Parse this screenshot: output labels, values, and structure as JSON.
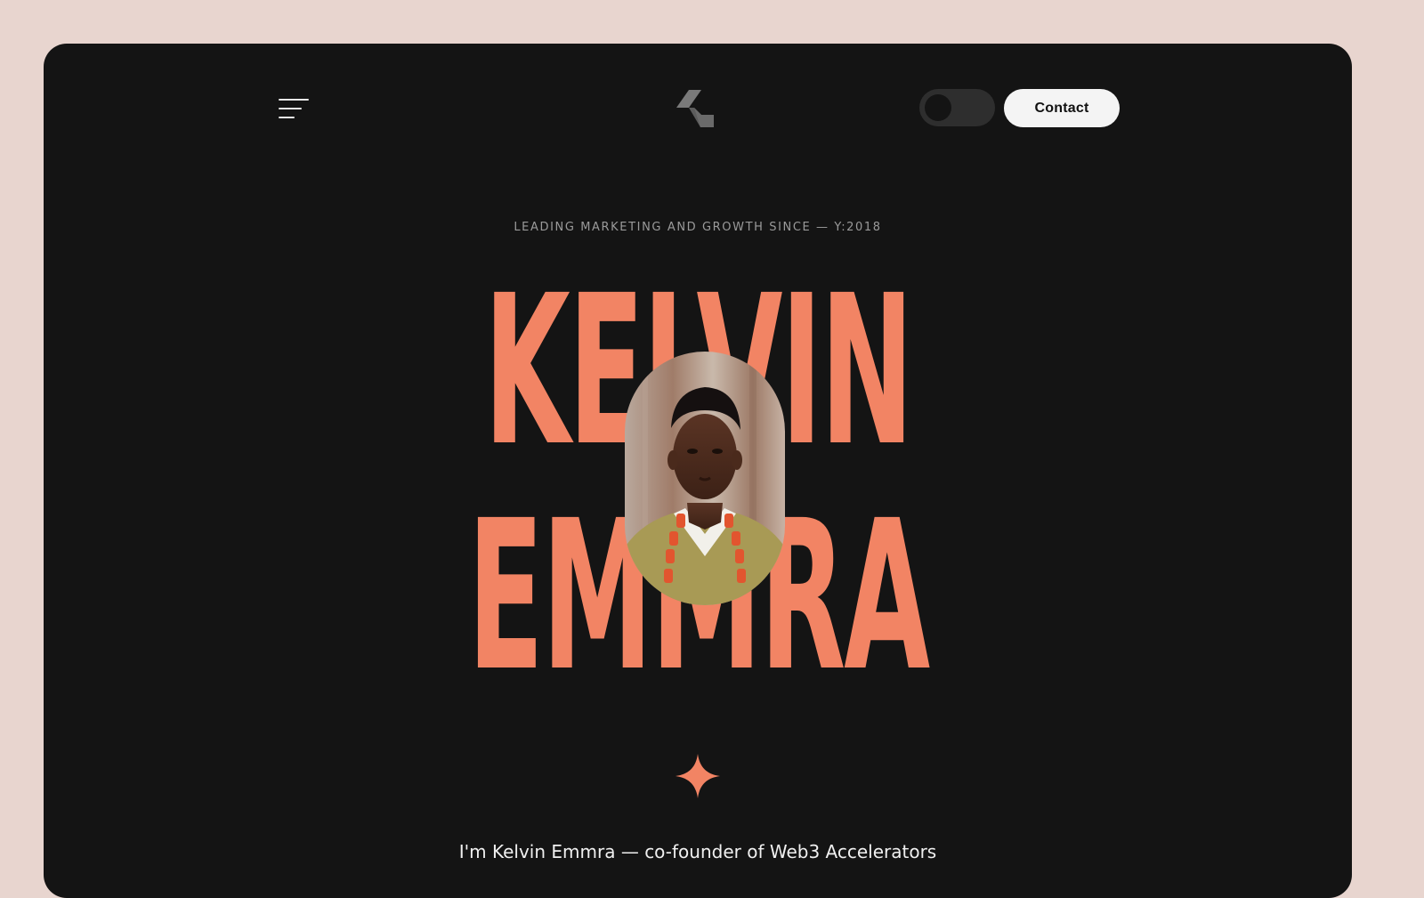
{
  "header": {
    "menu_icon": "hamburger-menu-icon",
    "logo_icon": "k-logo-icon",
    "theme_toggle": "theme-toggle",
    "contact_label": "Contact"
  },
  "hero": {
    "tagline": "LEADING MARKETING AND GROWTH SINCE — Y:2018",
    "first_name": "KELVIN",
    "last_name": "EMMRA",
    "portrait_alt": "Portrait photo",
    "sparkle_icon": "sparkle-icon",
    "intro": "I'm Kelvin Emmra — co-founder of Web3 Accelerators"
  },
  "colors": {
    "page_bg": "#e8d5cf",
    "frame_bg": "#141414",
    "accent": "#f28464",
    "button_bg": "#f4f4f4"
  }
}
